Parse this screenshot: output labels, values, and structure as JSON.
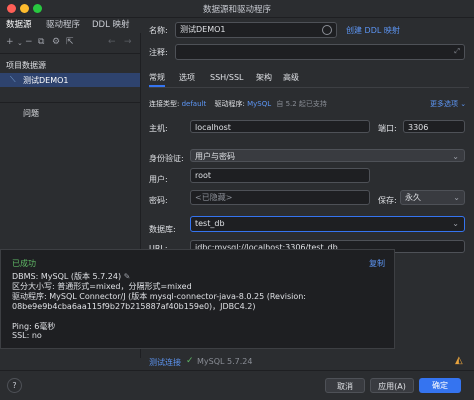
{
  "window": {
    "title": "数据源和驱动程序"
  },
  "left_tabs": [
    "数据源",
    "驱动程序",
    "DDL 映射"
  ],
  "left_tree": {
    "section": "项目数据源",
    "datasource": "测试DEMO1",
    "problems": "问题"
  },
  "form": {
    "name_label": "名称:",
    "name_value": "测试DEMO1",
    "create_ddl": "创建 DDL 映射",
    "comment_label": "注释:",
    "subtabs": [
      "常规",
      "选项",
      "SSH/SSL",
      "架构",
      "高级"
    ],
    "conn_type_label": "连接类型:",
    "conn_type_value": "default",
    "driver_label": "驱动程序:",
    "driver_value": "MySQL",
    "driver_note": "自 5.2 起已支持",
    "more_options": "更多选项 ⌄",
    "host_label": "主机:",
    "host_value": "localhost",
    "port_label": "端口:",
    "port_value": "3306",
    "auth_label": "身份验证:",
    "auth_value": "用户与密码",
    "user_label": "用户:",
    "user_value": "root",
    "password_label": "密码:",
    "password_placeholder": "<已隐藏>",
    "save_label": "保存:",
    "save_value": "永久",
    "db_label": "数据库:",
    "db_value": "test_db",
    "url_label": "URL:",
    "url_value": "jdbc:mysql://localhost:3306/test_db"
  },
  "popup": {
    "status": "已成功",
    "copy": "复制",
    "lines": [
      "DBMS: MySQL (版本 5.7.24)",
      "区分大小写: 普通形式=mixed，分隔形式=mixed",
      "驱动程序: MySQL Connector/J (版本 mysql-connector-java-8.0.25 (Revision:",
      "08be9e9b4cba6aa115f9b27b215887af40b159e0)，JDBC4.2)",
      "",
      "Ping: 6毫秒",
      "SSL: no"
    ]
  },
  "footer": {
    "test_link": "测试连接",
    "test_result": "MySQL 5.7.24",
    "help": "?",
    "cancel": "取消",
    "apply": "应用(A)",
    "ok": "确定"
  },
  "colors": {
    "accent": "#3574f0",
    "success": "#5fb865",
    "link": "#5d96f5",
    "bg": "#2b2d30",
    "field": "#1e1f22"
  },
  "icons": [
    "plus-icon",
    "minus-icon",
    "copy-icon",
    "settings-icon",
    "export-icon",
    "back-icon",
    "forward-icon",
    "mysql-icon",
    "check-icon",
    "edit-icon"
  ]
}
